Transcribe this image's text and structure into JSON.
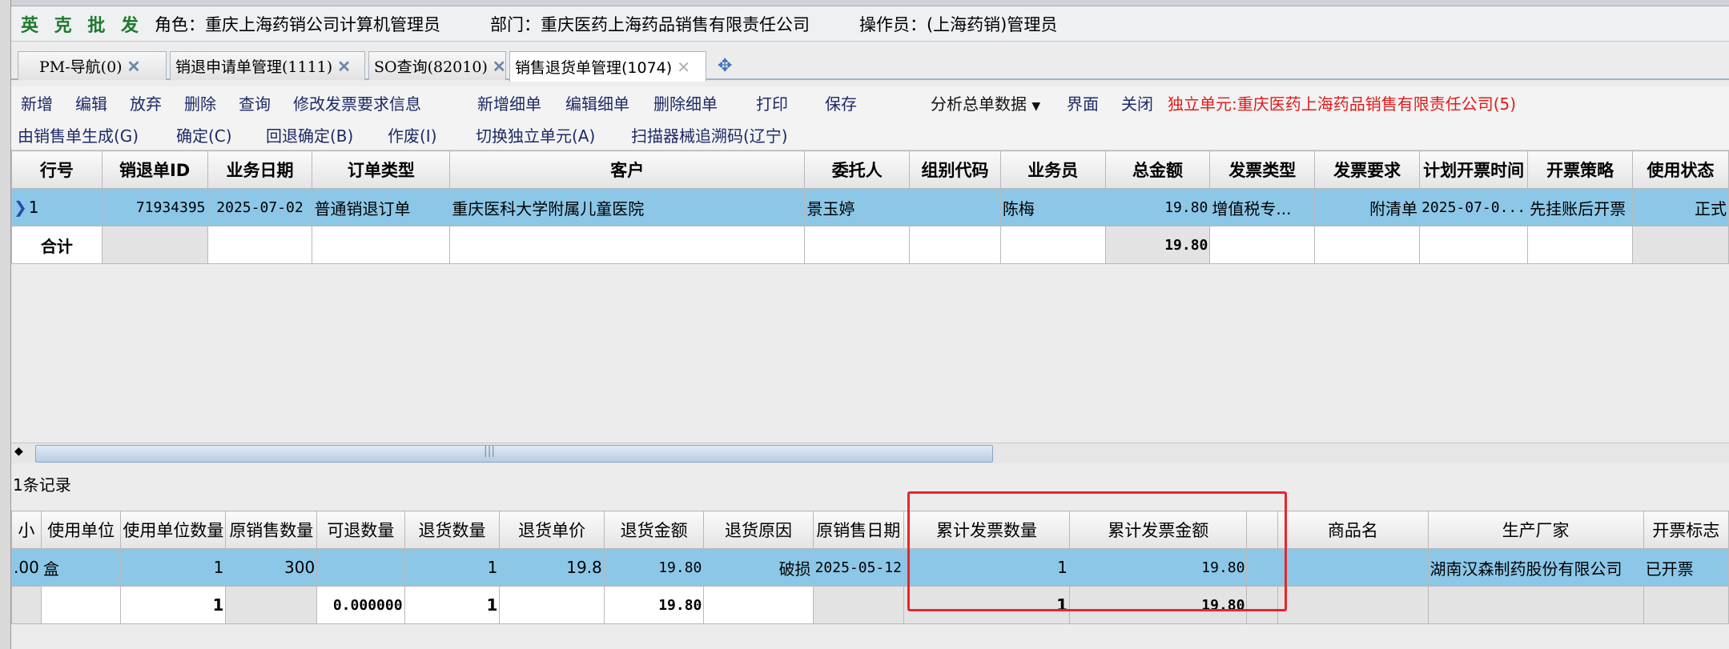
{
  "header": {
    "brand": "英 克 批 发",
    "role": "角色：重庆上海药销公司计算机管理员",
    "dept": "部门：重庆医药上海药品销售有限责任公司",
    "operator": "操作员：(上海药销)管理员"
  },
  "tabs": [
    {
      "label": "PM-导航(0)",
      "active": false
    },
    {
      "label": "销退申请单管理(1111)",
      "active": false
    },
    {
      "label": "SO查询(82010)",
      "active": false
    },
    {
      "label": "销售退货单管理(1074)",
      "active": true
    }
  ],
  "toolbar1": {
    "add": "新增",
    "edit": "编辑",
    "discard": "放弃",
    "delete": "删除",
    "query": "查询",
    "modify_invoice": "修改发票要求信息",
    "add_detail": "新增细单",
    "edit_detail": "编辑细单",
    "delete_detail": "删除细单",
    "print": "打印",
    "save": "保存",
    "analyze": "分析总单数据",
    "ui": "界面",
    "close": "关闭",
    "independent_unit": "独立单元:重庆医药上海药品销售有限责任公司(5)"
  },
  "toolbar2": {
    "gen_from_sales": "由销售单生成(G)",
    "confirm": "确定(C)",
    "rollback": "回退确定(B)",
    "void": "作废(I)",
    "switch_unit": "切换独立单元(A)",
    "scanner": "扫描器械追溯码(辽宁)"
  },
  "upper_grid": {
    "headers": [
      "行号",
      "销退单ID",
      "业务日期",
      "订单类型",
      "客户",
      "委托人",
      "组别代码",
      "业务员",
      "总金额",
      "发票类型",
      "发票要求",
      "计划开票时间",
      "开票策略",
      "使用状态"
    ],
    "rows": [
      [
        "1",
        "71934395",
        "2025-07-02",
        "普通销退订单",
        "重庆医科大学附属儿童医院",
        "景玉婷",
        "",
        "陈梅",
        "19.80",
        "增值税专...",
        "附清单",
        "2025-07-0...",
        "先挂账后开票",
        "正式"
      ]
    ],
    "summary": [
      "合计",
      "",
      "",
      "",
      "",
      "",
      "",
      "",
      "19.80",
      "",
      "",
      "",
      "",
      ""
    ]
  },
  "record_count": "1条记录",
  "lower_grid": {
    "headers": [
      "小",
      "使用单位",
      "使用单位数量",
      "原销售数量",
      "可退数量",
      "退货数量",
      "退货单价",
      "退货金额",
      "退货原因",
      "原销售日期",
      "累计发票数量",
      "累计发票金额",
      "",
      "商品名",
      "生产厂家",
      "开票标志"
    ],
    "rows": [
      [
        ".00",
        "盒",
        "1",
        "300",
        "",
        "1",
        "19.8",
        "19.80",
        "破损",
        "2025-05-12",
        "1",
        "19.80",
        "",
        "",
        "湖南汉森制药股份有限公司",
        "已开票"
      ]
    ],
    "summary": [
      "",
      "",
      "1",
      "",
      "0.000000",
      "1",
      "",
      "19.80",
      "",
      "",
      "1",
      "19.80",
      "",
      "",
      "",
      ""
    ]
  },
  "colors": {
    "selected_row": "#8cc7e8",
    "brand_green": "#1f7a2e",
    "alert_red": "#e21a1a",
    "highlight_box": "#e8252a"
  }
}
